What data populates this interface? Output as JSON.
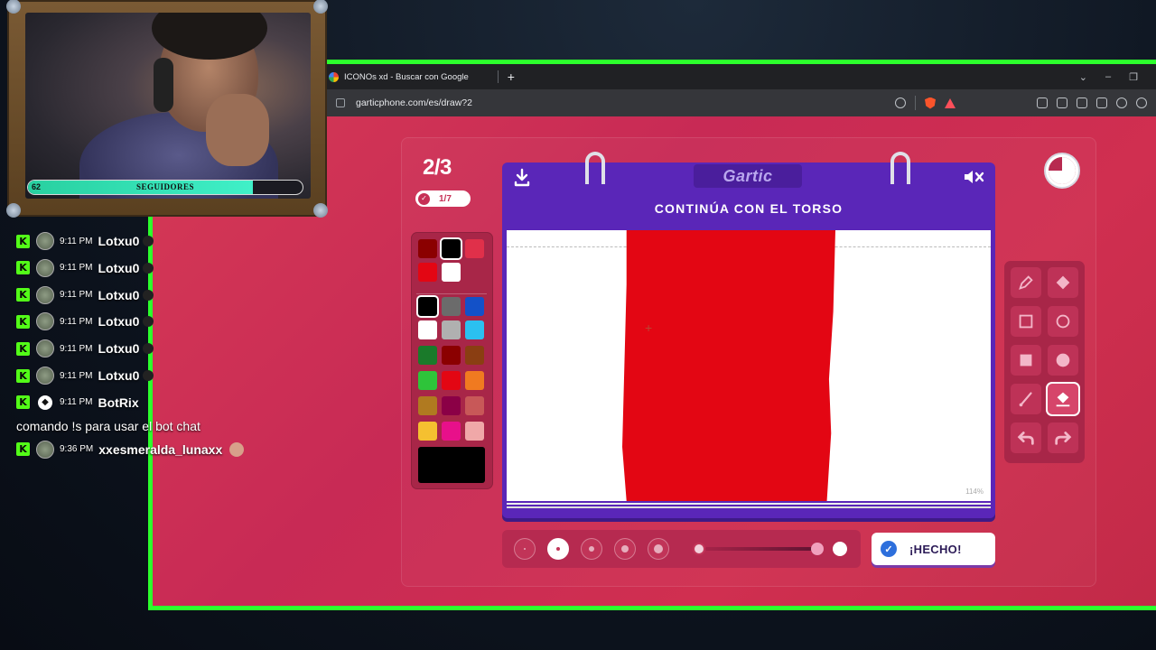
{
  "browser": {
    "tab_title": "ICONOs xd - Buscar con Google",
    "new_tab": "+",
    "url": "garticphone.com/es/draw?2",
    "window_controls": [
      "⌄",
      "–",
      "❐"
    ]
  },
  "game": {
    "round": "2/3",
    "progress": "1/7",
    "logo": "Gartic",
    "prompt": "CONTINÚA CON EL TORSO",
    "zoom": "114%",
    "done_label": "¡HECHO!",
    "timer_fraction_remaining": 0.75,
    "opacity_level": 1.0,
    "selected_brush_size_index": 1,
    "selected_color": "#000000",
    "palette": [
      "#8b0000",
      "#000000",
      "#e0304a",
      "#e30613",
      "#ffffff",
      "#000000",
      "#6b6b6b",
      "#1351c8",
      "#ffffff",
      "#b0b0b0",
      "#2bc0f0",
      "#1a7a2a",
      "#8b0000",
      "#8a3e12",
      "#2ec43a",
      "#e30613",
      "#f07a20",
      "#b07a20",
      "#8b0046",
      "#c85858",
      "#f5c030",
      "#e8108a",
      "#f0a8a8"
    ],
    "tools": [
      "pencil-icon",
      "eraser-icon",
      "rectangle-outline-icon",
      "circle-outline-icon",
      "rectangle-fill-icon",
      "circle-fill-icon",
      "line-icon",
      "bucket-fill-icon",
      "undo-icon",
      "redo-icon"
    ],
    "active_tool": "bucket-fill-icon",
    "stroke_color": "#e30613"
  },
  "webcam": {
    "followers_count": "62",
    "followers_label": "SEGUIDORES",
    "followers_progress": 0.82
  },
  "chat": {
    "messages": [
      {
        "time": "9:11 PM",
        "user": "Lotxu0"
      },
      {
        "time": "9:11 PM",
        "user": "Lotxu0"
      },
      {
        "time": "9:11 PM",
        "user": "Lotxu0"
      },
      {
        "time": "9:11 PM",
        "user": "Lotxu0"
      },
      {
        "time": "9:11 PM",
        "user": "Lotxu0"
      },
      {
        "time": "9:11 PM",
        "user": "Lotxu0"
      },
      {
        "time": "9:11 PM",
        "user": "BotRix"
      }
    ],
    "bot_message": "comando !s para usar el bot chat",
    "last_message": {
      "time": "9:36 PM",
      "user": "xxesmeralda_lunaxx"
    }
  }
}
